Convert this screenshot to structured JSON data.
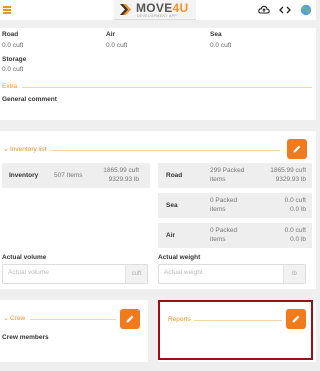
{
  "header": {
    "logo_title_a": "MOVE",
    "logo_title_b": "4U",
    "logo_subtitle": "DEVELOPMENT APP",
    "colors": {
      "accent": "#f0932b",
      "button": "#f07a1c",
      "highlight": "#a30d12"
    },
    "icons": [
      "hamburger-icon",
      "cloud-upload-icon",
      "code-icon",
      "globe-icon"
    ]
  },
  "transport": {
    "road": {
      "label": "Road",
      "value": "0.0 cuft"
    },
    "air": {
      "label": "Air",
      "value": "0.0 cuft"
    },
    "sea": {
      "label": "Sea",
      "value": "0.0 cuft"
    },
    "storage": {
      "label": "Storage",
      "value": "0.0 cuft"
    },
    "extra_label": "Extra",
    "general_comment_label": "General comment"
  },
  "inventory": {
    "section_label": "Inventory list",
    "summary": {
      "name": "Inventory",
      "items": "507 Items",
      "volume": "1865.99 cuft",
      "weight": "9329.93 lb"
    },
    "modes": [
      {
        "name": "Road",
        "items_line1": "299  Packed",
        "items_line2": "items",
        "volume": "1865.99 cuft",
        "weight": "9329.93 lb"
      },
      {
        "name": "Sea",
        "items_line1": "0 Packed",
        "items_line2": "items",
        "volume": "0.0 cuft",
        "weight": "0.0 lb"
      },
      {
        "name": "Air",
        "items_line1": "0 Packed",
        "items_line2": "items",
        "volume": "0.0 cuft",
        "weight": "0.0 lb"
      }
    ],
    "actual_volume": {
      "label": "Actual volume",
      "placeholder": "Actual volume",
      "unit": "cuft"
    },
    "actual_weight": {
      "label": "Actual weight",
      "placeholder": "Actual weight",
      "unit": "lb"
    }
  },
  "crew": {
    "section_label": "Crew",
    "members_label": "Crew members"
  },
  "reports": {
    "section_label": "Reports"
  }
}
